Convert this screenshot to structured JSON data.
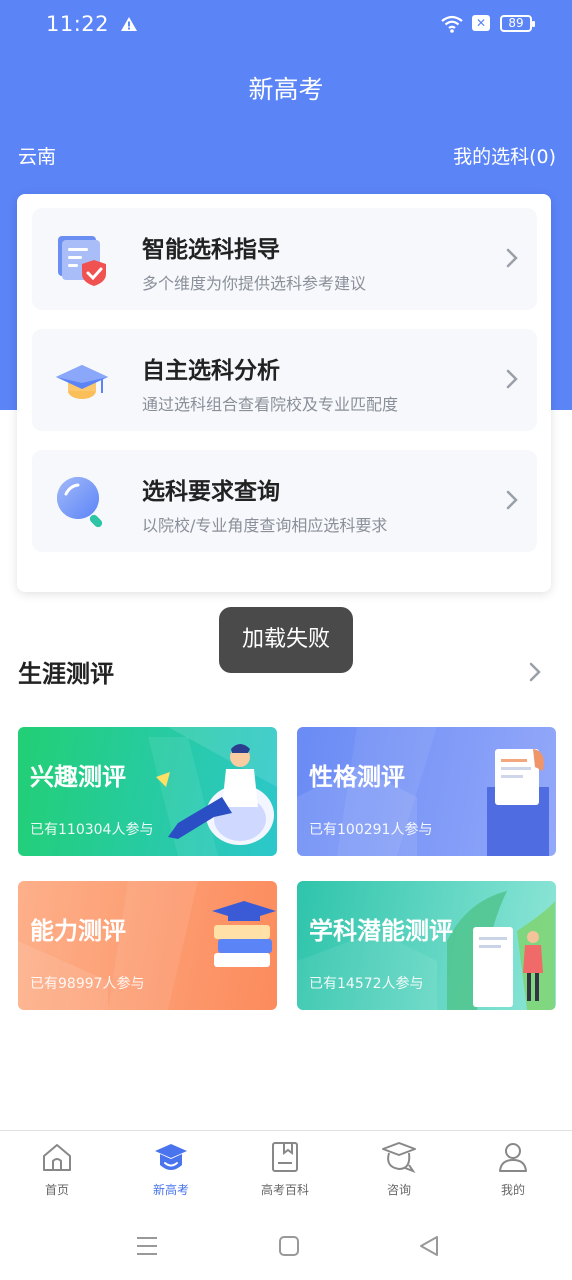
{
  "status_bar": {
    "time": "11:22",
    "battery": "89"
  },
  "header": {
    "title": "新高考",
    "region": "云南",
    "my_selection": "我的选科(0)"
  },
  "menu_items": [
    {
      "title": "智能选科指导",
      "subtitle": "多个维度为你提供选科参考建议",
      "icon": "document-shield-icon"
    },
    {
      "title": "自主选科分析",
      "subtitle": "通过选科组合查看院校及专业匹配度",
      "icon": "graduation-cap-icon"
    },
    {
      "title": "选科要求查询",
      "subtitle": "以院校/专业角度查询相应选科要求",
      "icon": "magnifier-icon"
    }
  ],
  "toast": "加载失败",
  "career": {
    "title": "生涯测评",
    "tests": [
      {
        "name": "兴趣测评",
        "count": "已有110304人参与",
        "color_start": "#23cf7c",
        "color_end": "#2cc6c9"
      },
      {
        "name": "性格测评",
        "count": "已有100291人参与",
        "color_start": "#6f8df6",
        "color_end": "#8ea2f8"
      },
      {
        "name": "能力测评",
        "count": "已有98997人参与",
        "color_start": "#fba079",
        "color_end": "#fc8e5f"
      },
      {
        "name": "学科潜能测评",
        "count": "已有14572人参与",
        "color_start": "#2fc7ae",
        "color_end": "#8de4d7"
      }
    ]
  },
  "tabbar": [
    {
      "label": "首页",
      "icon": "home-icon"
    },
    {
      "label": "新高考",
      "icon": "mortarboard-smile-icon",
      "active": true
    },
    {
      "label": "高考百科",
      "icon": "book-icon"
    },
    {
      "label": "咨询",
      "icon": "consult-cap-icon"
    },
    {
      "label": "我的",
      "icon": "person-icon"
    }
  ],
  "colors": {
    "primary": "#5b84f7",
    "active_tab": "#4a74ee"
  }
}
